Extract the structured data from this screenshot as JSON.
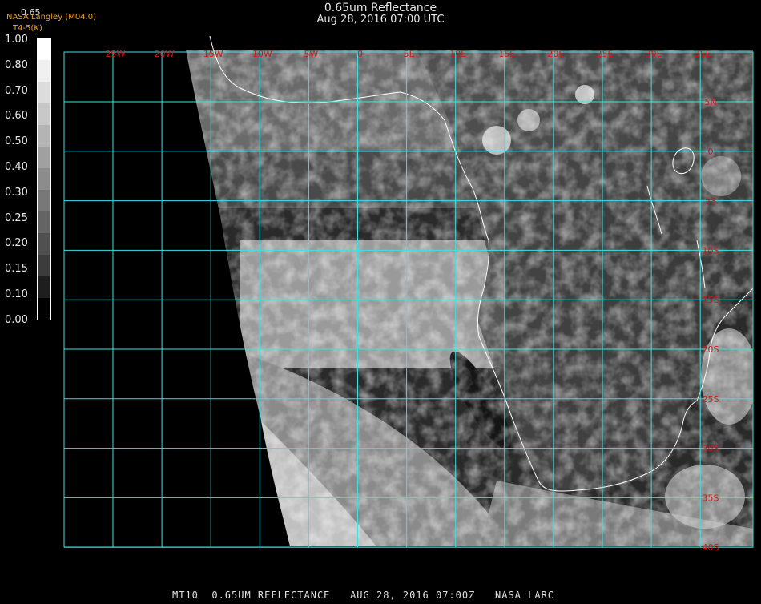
{
  "header": {
    "title": "0.65um Reflectance",
    "subtitle": "Aug 28, 2016 07:00 UTC",
    "credit": "NASA Langley (M04.0)",
    "subcredit": "T4-5(K)",
    "band_label": "0.65"
  },
  "scale": {
    "labels": [
      "1.00",
      "0.80",
      "0.70",
      "0.60",
      "0.50",
      "0.40",
      "0.30",
      "0.25",
      "0.20",
      "0.15",
      "0.10",
      "0.00"
    ],
    "colors": [
      "#ffffff",
      "#f0f0f0",
      "#dcdcdc",
      "#c8c8c8",
      "#b4b4b4",
      "#a0a0a0",
      "#8c8c8c",
      "#787878",
      "#646464",
      "#505050",
      "#3c3c3c",
      "#1e1e1e",
      "#000000"
    ]
  },
  "map": {
    "lon_labels": [
      "25W",
      "20W",
      "15W",
      "10W",
      "5W",
      "0",
      "5E",
      "10E",
      "15E",
      "20E",
      "25E",
      "30E",
      "35E"
    ],
    "lat_labels": [
      "5N",
      "0",
      "5S",
      "10S",
      "15S",
      "20S",
      "25S",
      "30S",
      "35S",
      "40S"
    ],
    "grid_color": "#40e0e0",
    "label_color": "#d01818"
  },
  "footer": {
    "text": "MT10  0.65UM REFLECTANCE   AUG 28, 2016 07:00Z   NASA LARC"
  }
}
